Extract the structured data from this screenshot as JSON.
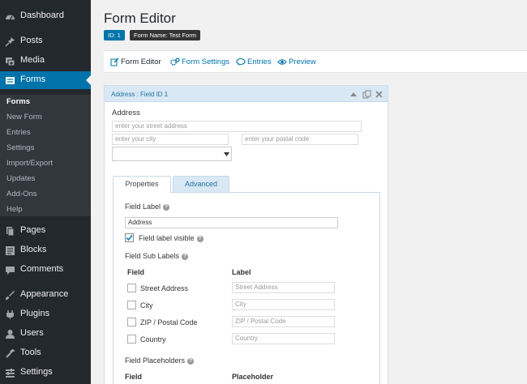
{
  "sidebar": {
    "top_items": [
      {
        "label": "Dashboard",
        "icon": "dashboard-icon"
      },
      {
        "label": "Posts",
        "icon": "pin-icon"
      },
      {
        "label": "Media",
        "icon": "media-icon"
      },
      {
        "label": "Forms",
        "icon": "forms-icon"
      }
    ],
    "sub_items": [
      "Forms",
      "New Form",
      "Entries",
      "Settings",
      "Import/Export",
      "Updates",
      "Add-Ons",
      "Help"
    ],
    "bottom_items": [
      {
        "label": "Pages",
        "icon": "pages-icon"
      },
      {
        "label": "Blocks",
        "icon": "blocks-icon"
      },
      {
        "label": "Comments",
        "icon": "comment-icon"
      },
      {
        "label": "Appearance",
        "icon": "brush-icon"
      },
      {
        "label": "Plugins",
        "icon": "plug-icon"
      },
      {
        "label": "Users",
        "icon": "user-icon"
      },
      {
        "label": "Tools",
        "icon": "wrench-icon"
      },
      {
        "label": "Settings",
        "icon": "settings-icon"
      }
    ]
  },
  "header": {
    "title": "Form Editor",
    "id_badge": "ID: 1",
    "name_badge": "Form Name: Test Form"
  },
  "toolbar": {
    "form_editor": "Form Editor",
    "form_settings": "Form Settings",
    "entries": "Entries",
    "preview": "Preview"
  },
  "panel": {
    "title": "Address : Field ID 1",
    "field_label": "Address",
    "street_placeholder": "enter your street address",
    "city_placeholder": "enter your city",
    "postal_placeholder": "enter your postal code",
    "tabs": {
      "properties": "Properties",
      "advanced": "Advanced"
    },
    "props": {
      "field_label_heading": "Field Label",
      "field_label_value": "Address",
      "label_visible": "Field label visible",
      "sub_labels_heading": "Field Sub Labels",
      "col_field": "Field",
      "col_label": "Label",
      "rows": [
        {
          "field": "Street Address",
          "label_placeholder": "Street Address"
        },
        {
          "field": "City",
          "label_placeholder": "City"
        },
        {
          "field": "ZIP / Postal Code",
          "label_placeholder": "ZIP / Postal Code"
        },
        {
          "field": "Country",
          "label_placeholder": "Country"
        }
      ],
      "placeholders_heading": "Field Placeholders",
      "col_placeholder": "Placeholder"
    }
  },
  "colors": {
    "sidebar_bg": "#23282d",
    "accent": "#0073aa",
    "panel_header": "#d9e8f5"
  }
}
